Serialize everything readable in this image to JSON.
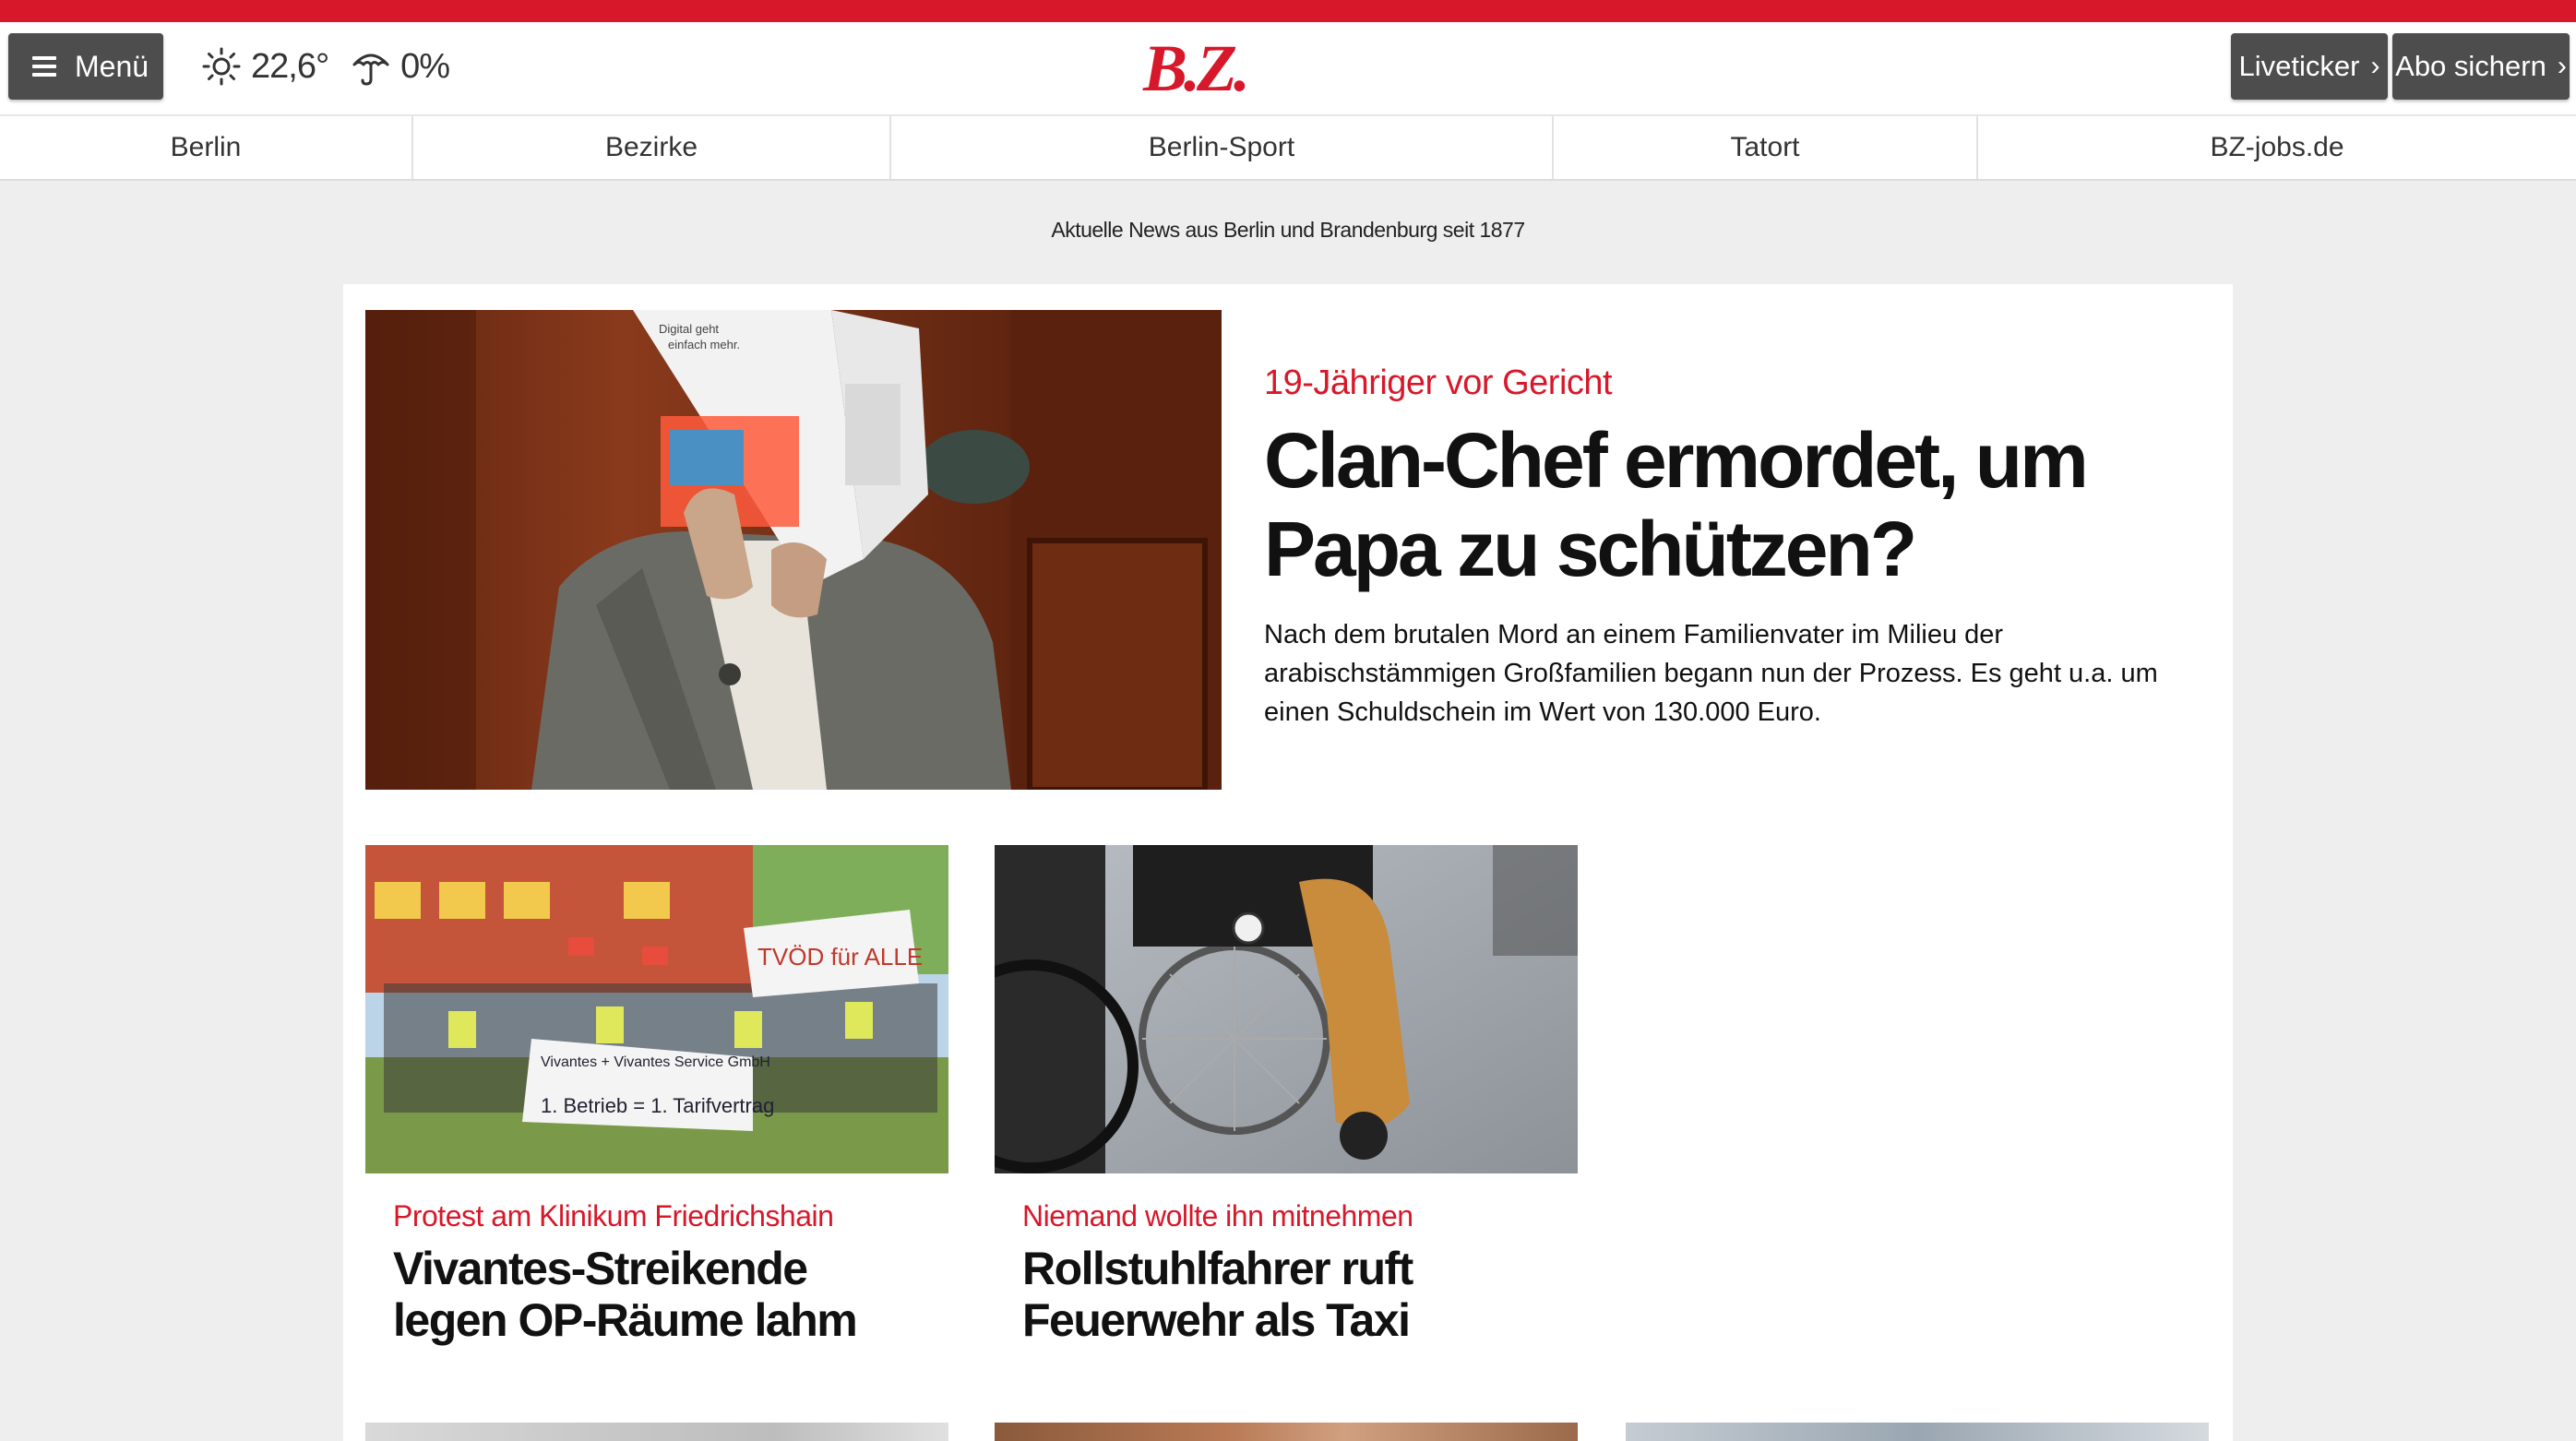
{
  "header": {
    "menu_label": "Menü",
    "weather": {
      "temperature": "22,6°",
      "rain_chance": "0%"
    },
    "logo_text": "B.Z.",
    "buttons": {
      "liveticker": "Liveticker",
      "abo": "Abo sichern"
    }
  },
  "nav": {
    "items": [
      {
        "label": "Berlin"
      },
      {
        "label": "Bezirke"
      },
      {
        "label": "Berlin-Sport"
      },
      {
        "label": "Tatort"
      },
      {
        "label": "BZ-jobs.de"
      }
    ]
  },
  "tagline": "Aktuelle News aus Berlin und Brandenburg seit 1877",
  "hero": {
    "kicker": "19-Jähriger vor Gericht",
    "headline": "Clan-Chef ermordet, um Papa zu schützen?",
    "teaser": "Nach dem brutalen Mord an einem Familienvater im Milieu der arabischstämmigen Großfamilien begann nun der Prozess. Es geht u.a. um einen Schuldschein im Wert von 130.000 Euro.",
    "image_text": {
      "flyer_line1": "Digital geht",
      "flyer_line2": "einfach mehr."
    }
  },
  "articles": [
    {
      "kicker": "Protest am Klinikum Friedrichshain",
      "headline": "Vivantes-Streikende legen OP-Räume lahm",
      "banner_text": {
        "top": "TVÖD für ALLE",
        "bottom": "1. Betrieb = 1. Tarifvertrag"
      }
    },
    {
      "kicker": "Niemand wollte ihn mitnehmen",
      "headline": "Rollstuhlfahrer ruft Feuerwehr als Taxi"
    }
  ],
  "colors": {
    "brand_red": "#d7182a",
    "button_gray": "#4d4d4d",
    "page_bg": "#eeeeee"
  }
}
